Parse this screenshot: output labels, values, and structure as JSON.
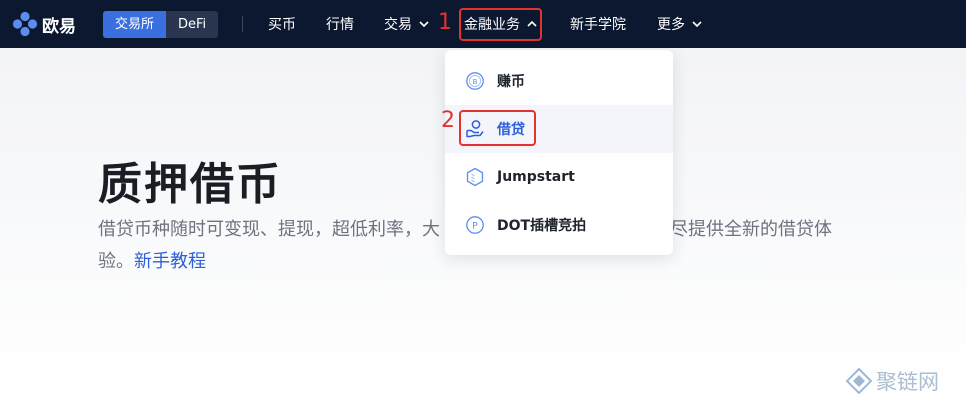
{
  "brand": {
    "name": "欧易"
  },
  "mode_switch": {
    "tabs": [
      "交易所",
      "DeFi"
    ],
    "active": "交易所"
  },
  "nav": {
    "items": [
      {
        "label": "买币",
        "has_dropdown": false
      },
      {
        "label": "行情",
        "has_dropdown": false
      },
      {
        "label": "交易",
        "has_dropdown": true
      },
      {
        "label": "金融业务",
        "has_dropdown": true,
        "expanded": true
      },
      {
        "label": "新手学院",
        "has_dropdown": false
      },
      {
        "label": "更多",
        "has_dropdown": true
      }
    ]
  },
  "dropdown": {
    "items": [
      {
        "label": "赚币",
        "icon": "coin-icon"
      },
      {
        "label": "借贷",
        "icon": "hand-coin-icon",
        "highlighted": true
      },
      {
        "label": "Jumpstart",
        "icon": "jumpstart-icon"
      },
      {
        "label": "DOT插槽竞拍",
        "icon": "dot-icon"
      }
    ]
  },
  "annotations": {
    "step1": "1",
    "step2": "2"
  },
  "hero": {
    "title": "质押借币",
    "desc_line1": "借贷币种随时可变现、提现，超低利率，大",
    "desc_tail": "尽提供全新的借贷体",
    "desc_line2_prefix": "验。",
    "tutorial_link": "新手教程"
  },
  "watermark": {
    "text": "聚链网"
  },
  "colors": {
    "nav_bg": "#0b1830",
    "accent": "#3a6fe0",
    "link": "#2d5fd8",
    "annotation_red": "#e6322e"
  }
}
